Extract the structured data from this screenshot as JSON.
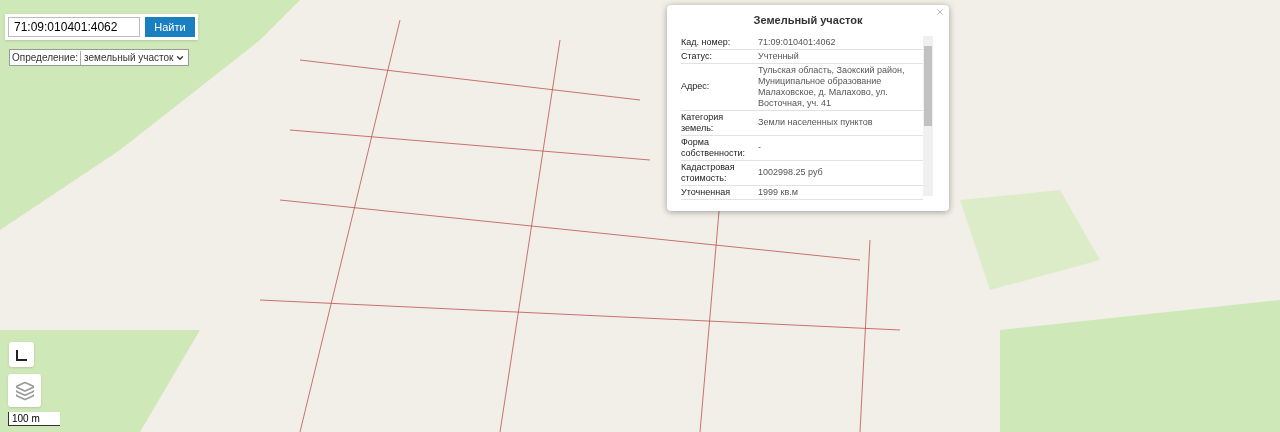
{
  "search": {
    "value": "71:09:010401:4062",
    "button": "Найти"
  },
  "definition": {
    "label": "Определение:",
    "value": "земельный участок"
  },
  "popup": {
    "title": "Земельный участок",
    "rows": [
      {
        "label": "Кад. номер:",
        "value": "71:09:010401:4062"
      },
      {
        "label": "Статус:",
        "value": "Учтенный"
      },
      {
        "label": "Адрес:",
        "value": "Тульская область, Заокский район, Муниципальное образование Малаховское, д. Малахово, ул. Восточная, уч. 41"
      },
      {
        "label": "Категория земель:",
        "value": "Земли населенных пунктов"
      },
      {
        "label": "Форма собственности:",
        "value": "-"
      },
      {
        "label": "Кадастровая стоимость:",
        "value": "1002998.25 руб"
      },
      {
        "label": "Уточненная",
        "value": "1999 кв.м"
      }
    ]
  },
  "scale": {
    "label": "100 m"
  }
}
